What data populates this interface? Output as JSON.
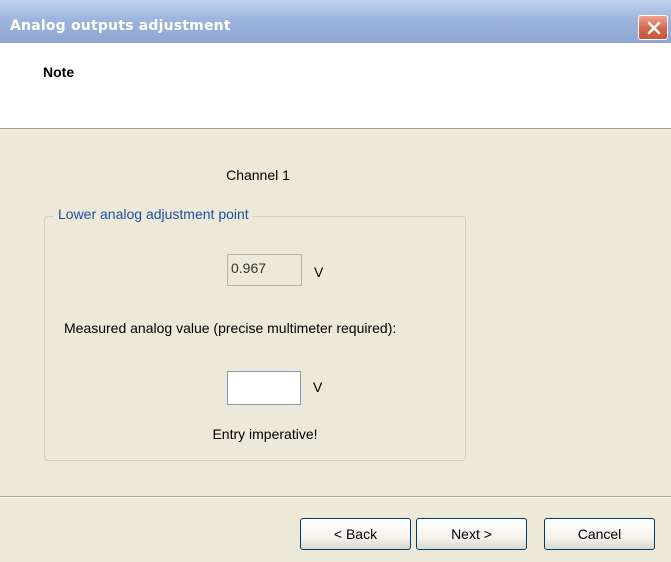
{
  "window": {
    "title": "Analog outputs adjustment"
  },
  "header": {
    "title": "Note"
  },
  "content": {
    "channel_label": "Channel 1",
    "group_title": "Lower analog adjustment point",
    "output_value": "0.967",
    "output_unit": "V",
    "measured_label": "Measured analog value (precise multimeter required):",
    "measured_value": "",
    "measured_unit": "V",
    "warning": "Entry imperative!"
  },
  "buttons": {
    "back": "< Back",
    "next": "Next >",
    "cancel": "Cancel"
  },
  "icons": {
    "close": "close-icon"
  }
}
